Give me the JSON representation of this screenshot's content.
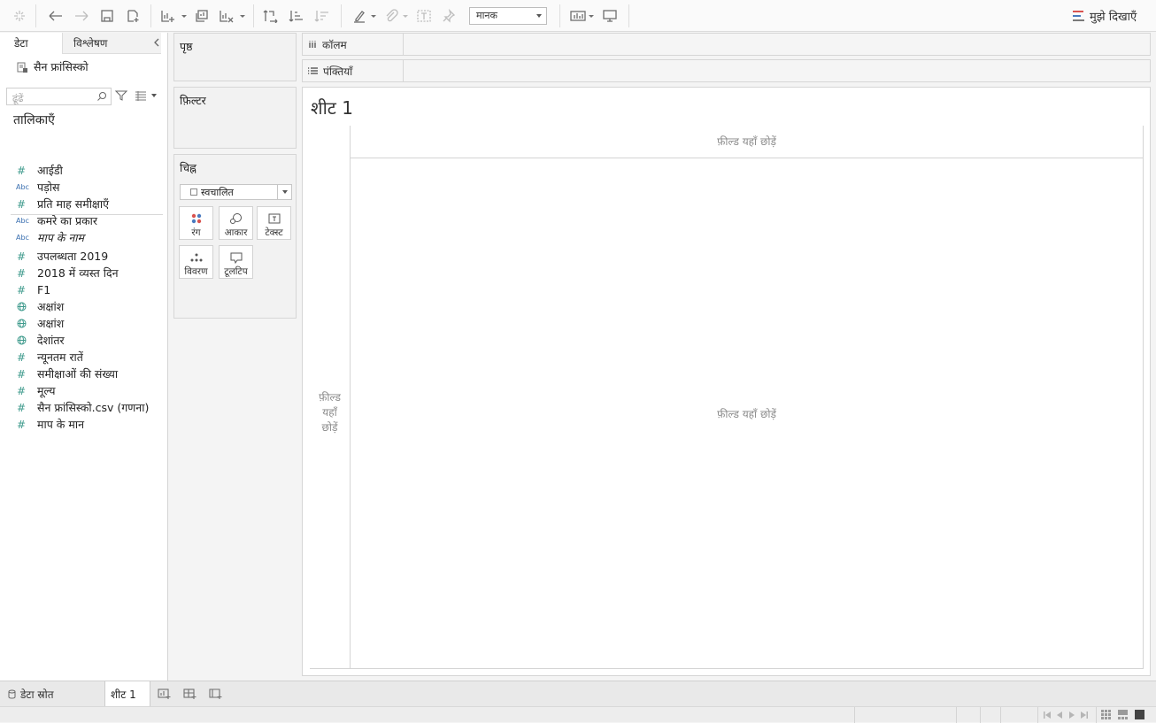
{
  "toolbar": {
    "fit_value": "मानक",
    "show_me": "मुझे दिखाएँ",
    "icons": [
      "tableau-logo-icon",
      "undo-icon",
      "redo-icon",
      "save-icon",
      "new-datasource-icon",
      "new-worksheet-icon",
      "duplicate-sheet-icon",
      "clear-sheet-icon",
      "swap-icon",
      "sort-ascending-icon",
      "sort-descending-icon",
      "highlight-icon",
      "group-icon",
      "labels-icon",
      "pin-icon",
      "show-cards-icon",
      "presentation-icon"
    ]
  },
  "left_pane": {
    "tabs": {
      "data": "डेटा",
      "analytics": "विश्लेषण"
    },
    "datasource": "सैन फ्रांसिस्को",
    "search_placeholder": "ढूंढें",
    "tables_header": "तालिकाएँ",
    "fields": [
      {
        "type": "#",
        "label": "आईडी"
      },
      {
        "type": "Abc",
        "label": "पड़ोस"
      },
      {
        "type": "#",
        "label": "प्रति माह समीक्षाएँ"
      },
      {
        "type": "Abc",
        "label": "कमरे का प्रकार"
      },
      {
        "type": "Abc",
        "label": "माप के नाम",
        "italic": true
      },
      {
        "type": "#",
        "label": "उपलब्धता 2019"
      },
      {
        "type": "#",
        "label": "2018 में व्यस्त दिन"
      },
      {
        "type": "#",
        "label": "F1"
      },
      {
        "type": "globe",
        "label": "अक्षांश"
      },
      {
        "type": "globe",
        "label": "अक्षांश"
      },
      {
        "type": "globe",
        "label": "देशांतर"
      },
      {
        "type": "#",
        "label": "न्यूनतम रातें"
      },
      {
        "type": "#",
        "label": "समीक्षाओं की संख्या"
      },
      {
        "type": "#",
        "label": "मूल्य"
      },
      {
        "type": "#",
        "label": "सैन फ्रांसिस्को.csv (गणना)"
      },
      {
        "type": "#",
        "label": "माप के मान"
      }
    ]
  },
  "cards": {
    "pages": "पृष्ठ",
    "filters": "फ़िल्टर",
    "marks": "चिह्न",
    "mark_type": "स्वचालित",
    "mark_buttons": {
      "color": "रंग",
      "size": "आकार",
      "text": "टेक्स्ट",
      "detail": "विवरण",
      "tooltip": "टूलटिप"
    }
  },
  "shelves": {
    "columns": "कॉलम",
    "rows": "पंक्तियाँ"
  },
  "view": {
    "title": "शीट 1",
    "drop_top": "फ़ील्ड यहाँ छोड़ें",
    "drop_center": "फ़ील्ड यहाँ छोड़ें",
    "drop_left": [
      "फ़ील्ड",
      "यहाँ",
      "छोड़ें"
    ]
  },
  "bottom": {
    "datasource_tab": "डेटा स्रोत",
    "sheet_tab": "शीट 1"
  },
  "colors": {
    "measure": "#3e9a8c",
    "dimension": "#3a6fb0",
    "showme_bars": [
      "#d9534f",
      "#4a7bbf",
      "#7a7a7a"
    ]
  }
}
